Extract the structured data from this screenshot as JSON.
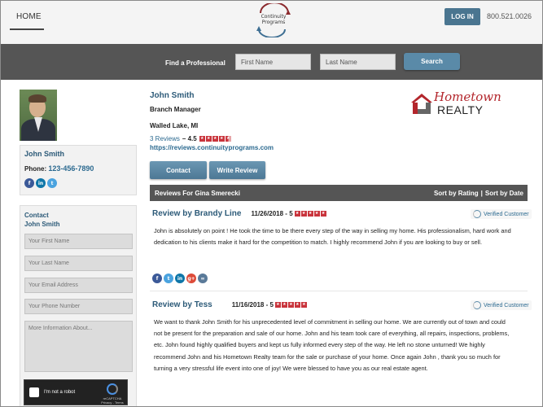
{
  "header": {
    "home_label": "HOME",
    "logo_text_line1": "Continuity",
    "logo_text_line2": "Programs",
    "login_label": "LOG IN",
    "phone": "800.521.0026"
  },
  "search": {
    "find_label": "Find a Professional",
    "first_name_placeholder": "First Name",
    "last_name_placeholder": "Last Name",
    "search_label": "Search"
  },
  "agent": {
    "name": "John Smith",
    "phone_label": "Phone:",
    "phone": "123-456-7890",
    "social_icons": [
      "facebook-icon",
      "linkedin-icon",
      "twitter-icon"
    ]
  },
  "contact_form": {
    "title_line1": "Contact",
    "title_line2": "John Smith",
    "first_name_placeholder": "Your First Name",
    "last_name_placeholder": "Your Last Name",
    "email_placeholder": "Your Email Address",
    "phone_placeholder": "Your Phone Number",
    "info_placeholder": "More Information About...",
    "recaptcha_label": "I'm not a robot",
    "recaptcha_brand": "reCAPTCHA",
    "recaptcha_links": "Privacy - Terms"
  },
  "profile": {
    "name": "John Smith",
    "title": "Branch Manager",
    "location": "Walled Lake, MI",
    "reviews_count": "3 Reviews",
    "rating_text": " – 4.5",
    "rating_stars": 4.5,
    "url": "https://reviews.continuityprograms.com",
    "contact_label": "Contact",
    "write_review_label": "Write Review"
  },
  "brand": {
    "line1": "Hometown",
    "line2": "REALTY",
    "color": "#b3262c"
  },
  "reviews_bar": {
    "title": "Reviews For Gina Smerecki",
    "sort_rating": "Sort by Rating",
    "separator": "|",
    "sort_date": "Sort by Date"
  },
  "reviews": [
    {
      "by": "Review by Brandy Line",
      "date": "11/26/2018 - 5",
      "stars": 5,
      "verified": "Verified Customer",
      "body": "John is absolutely on point ! He took the time to be there every step of the way in selling my home. His professionalism, hard work and dedication to his clients make it hard for the competition to match. I highly recommend John if you are looking to buy or sell.",
      "share_icons": [
        "facebook-icon",
        "twitter-icon",
        "linkedin-icon",
        "google-plus-icon",
        "link-icon"
      ]
    },
    {
      "by": "Review by Tess",
      "date": "11/16/2018 - 5",
      "stars": 5,
      "verified": "Verified Customer",
      "body": "We want to thank John Smith for his unprecedented level of commitment in selling our home. We are currently out of town and could not be present for the preparation and sale of our home. John and his team took care of everything, all repairs, inspections, problems, etc. John found highly qualified buyers and kept us fully informed every step of the way. He left no stone unturned! We highly recommend John and his Hometown Realty team for the sale or purchase of your home. Once again John , thank you so much for turning a very stressful life event into one of joy!  We were blessed to have you as our real estate agent."
    }
  ],
  "colors": {
    "accent": "#2c5a78",
    "button": "#4d7895",
    "bar": "#555555",
    "star": "#c9343c"
  }
}
